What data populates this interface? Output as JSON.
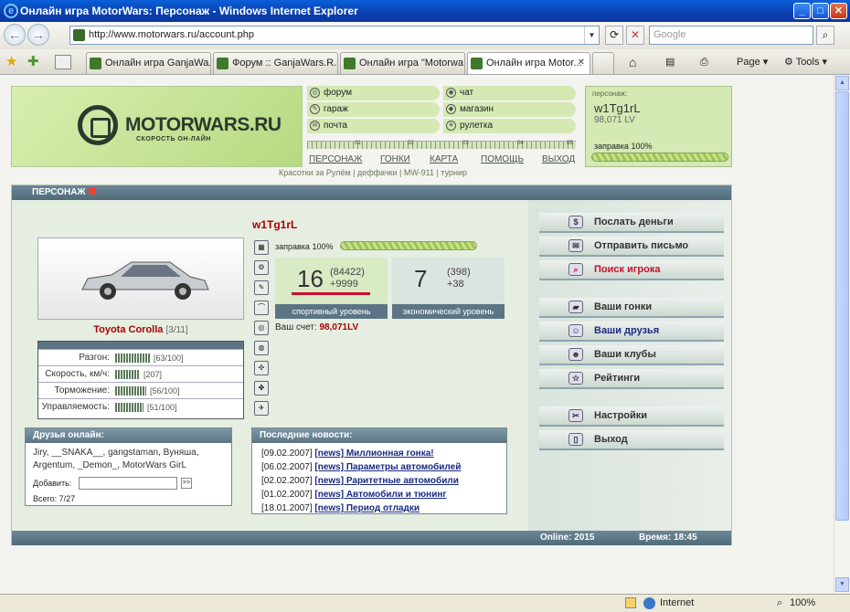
{
  "window": {
    "title": "Онлайн игра MotorWars: Персонаж - Windows Internet Explorer"
  },
  "browser": {
    "url": "http://www.motorwars.ru/account.php",
    "search_placeholder": "Google",
    "tabs": [
      {
        "label": "Онлайн игра GanjaWa..."
      },
      {
        "label": "Форум :: GanjaWars.R..."
      },
      {
        "label": "Онлайн игра \"Motorwa..."
      },
      {
        "label": "Онлайн игра Motor..."
      }
    ],
    "tools": {
      "page": "Page",
      "tools": "Tools"
    }
  },
  "status": {
    "zone": "Internet",
    "zoom": "100%"
  },
  "site": {
    "logo": "MOTORWARS.RU",
    "slogan": "СКОРОСТЬ ОН-ЛАЙН",
    "menu": [
      "форум",
      "чат",
      "гараж",
      "магазин",
      "почта",
      "рулетка"
    ],
    "ruler_ticks": [
      "01",
      "02",
      "03",
      "04",
      "05"
    ],
    "nav": [
      "ПЕРСОНАЖ",
      "ГОНКИ",
      "КАРТА",
      "ПОМОЩЬ",
      "ВЫХОД"
    ],
    "sublinks": "Красотки за Рулём | деффачки | MW-911 | турнир",
    "player": {
      "label": "персонаж:",
      "nick": "w1Tg1rL",
      "money": "98,071 LV",
      "fuel": "заправка 100%",
      "fuel_level": 1.0
    }
  },
  "main": {
    "title": "ПЕРСОНАЖ",
    "nick": "w1Tg1rL",
    "car": {
      "name": "Toyota Corolla",
      "slot": "[3/11]"
    },
    "stats": [
      {
        "label": "Разгон:",
        "value": "[63/100]",
        "level": 0.63
      },
      {
        "label": "Скорость, км/ч:",
        "value": "[207]",
        "level": 0.45
      },
      {
        "label": "Торможение:",
        "value": "[56/100]",
        "level": 0.56
      },
      {
        "label": "Управляемость:",
        "value": "[51/100]",
        "level": 0.51
      }
    ],
    "fuel": "заправка 100%",
    "fuel_level": 1.0,
    "sport": {
      "level": "16",
      "exp": "(84422)",
      "plus": "+9999",
      "label": "спортивный уровень"
    },
    "econ": {
      "level": "7",
      "exp": "(398)",
      "plus": "+38",
      "label": "экономический уровень"
    },
    "account_label": "Ваш счет:",
    "account_value": "98,071LV",
    "friends": {
      "title": "Друзья онлайн:",
      "list": "Jiry, __SNAKA__, gangstaman, Вуняша, Argentum, _Demon_, MotorWars GirL",
      "add_label": "Добавить:",
      "go": ">>",
      "total": "Всего: 7/27"
    },
    "news": {
      "title": "Последние новости:",
      "items": [
        {
          "date": "[09.02.2007]",
          "text": "[news] Миллионная гонка!"
        },
        {
          "date": "[06.02.2007]",
          "text": "[news] Параметры автомобилей"
        },
        {
          "date": "[02.02.2007]",
          "text": "[news] Раритетные автомобили"
        },
        {
          "date": "[01.02.2007]",
          "text": "[news] Автомобили и тюнинг"
        },
        {
          "date": "[18.01.2007]",
          "text": "[news] Период отладки"
        }
      ]
    },
    "actions": [
      "Послать деньги",
      "Отправить письмо",
      "Поиск игрока",
      "Ваши гонки",
      "Ваши друзья",
      "Ваши клубы",
      "Рейтинги",
      "Настройки",
      "Выход"
    ],
    "footer": {
      "online": "Online: 2015",
      "time": "Время: 18:45"
    }
  }
}
